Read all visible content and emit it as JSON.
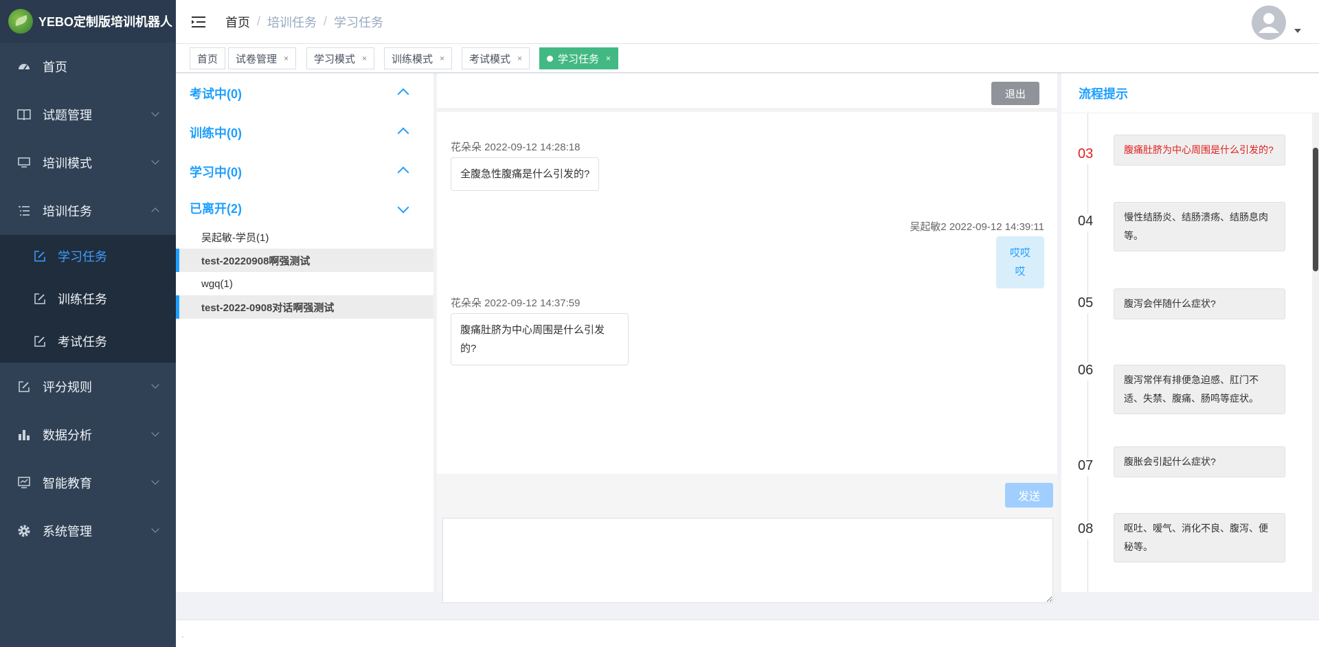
{
  "brand": {
    "title": "YEBO定制版培训机器人"
  },
  "sidebar": {
    "items": [
      {
        "label": "首页",
        "icon": "dashboard-icon"
      },
      {
        "label": "试题管理",
        "icon": "book-icon"
      },
      {
        "label": "培训模式",
        "icon": "monitor-icon"
      },
      {
        "label": "培训任务",
        "icon": "list-icon"
      },
      {
        "label": "评分规则",
        "icon": "edit-icon"
      },
      {
        "label": "数据分析",
        "icon": "bar-chart-icon"
      },
      {
        "label": "智能教育",
        "icon": "screen-icon"
      },
      {
        "label": "系统管理",
        "icon": "gear-icon"
      }
    ],
    "sub_items": [
      {
        "label": "学习任务",
        "active": true
      },
      {
        "label": "训练任务",
        "active": false
      },
      {
        "label": "考试任务",
        "active": false
      }
    ]
  },
  "header": {
    "breadcrumb": [
      "首页",
      "培训任务",
      "学习任务"
    ]
  },
  "tags": [
    {
      "label": "首页"
    },
    {
      "label": "试卷管理",
      "close": "×"
    },
    {
      "label": "学习模式",
      "close": "×"
    },
    {
      "label": "训练模式",
      "close": "×"
    },
    {
      "label": "考试模式",
      "close": "×"
    },
    {
      "label": "学习任务",
      "close": "×",
      "active": true
    }
  ],
  "status_groups": [
    {
      "label": "考试中(0)"
    },
    {
      "label": "训练中(0)"
    },
    {
      "label": "学习中(0)"
    },
    {
      "label": "已离开(2)"
    }
  ],
  "left_items": [
    {
      "label": "吴起敏-学员(1)"
    },
    {
      "label": "test-20220908啊强测试"
    },
    {
      "label": "wgq(1)"
    },
    {
      "label": "test-2022-0908对话啊强测试"
    }
  ],
  "chat": {
    "exit_label": "退出",
    "send_label": "发送",
    "messages": [
      {
        "meta": "花朵朵 2022-09-12 14:28:18",
        "text": "全腹急性腹痛是什么引发的?"
      },
      {
        "meta": "吴起敏2 2022-09-12 14:39:11",
        "text": "哎哎哎"
      },
      {
        "meta": "花朵朵 2022-09-12 14:37:59",
        "text": "腹痛肚脐为中心周围是什么引发的?"
      }
    ],
    "input_value": ""
  },
  "flow": {
    "title": "流程提示",
    "steps": [
      {
        "num": "03",
        "text": "腹痛肚脐为中心周围是什么引发的?",
        "highlight": true
      },
      {
        "num": "04",
        "text": "慢性结肠炎、结肠溃疡、结肠息肉等。"
      },
      {
        "num": "05",
        "text": "腹泻会伴随什么症状?"
      },
      {
        "num": "06",
        "text": "腹泻常伴有排便急迫感、肛门不适、失禁、腹痛、肠鸣等症状。"
      },
      {
        "num": "07",
        "text": "腹胀会引起什么症状?"
      },
      {
        "num": "08",
        "text": "呕吐、嗳气、消化不良、腹泻、便秘等。"
      }
    ]
  },
  "footer": {
    "text": "."
  },
  "colors": {
    "sidebar_bg": "#304156",
    "accent": "#1e9fff",
    "active_tag": "#42b983",
    "highlight": "#e02020"
  }
}
